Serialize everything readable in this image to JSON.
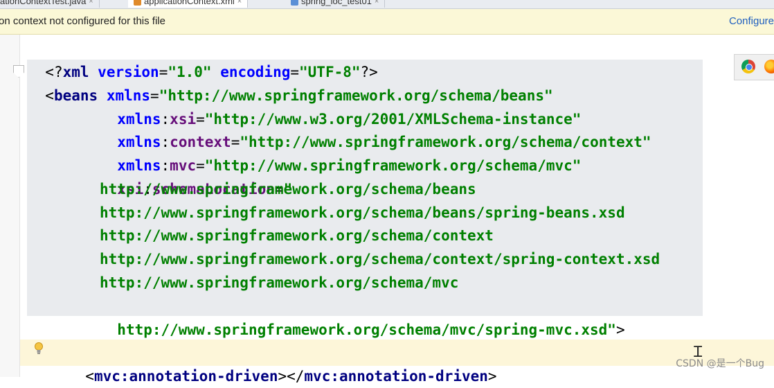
{
  "tabs": [
    {
      "label": "ationContextTest.java",
      "close": "×",
      "active": false
    },
    {
      "label": "applicationContext.xml",
      "close": "×",
      "active": true
    },
    {
      "label": "spring_ioc_test01",
      "close": "×",
      "active": false
    }
  ],
  "banner": {
    "message": "on context not configured for this file",
    "action": "Configure"
  },
  "code": {
    "line1": {
      "open": "<?",
      "tag": "xml",
      "attr1": " version",
      "eq1": "=",
      "val1": "\"1.0\"",
      "attr2": " encoding",
      "eq2": "=",
      "val2": "\"UTF-8\"",
      "close": "?>"
    },
    "line2": {
      "open": "<",
      "tag": "beans",
      "attr": " xmlns",
      "eq": "=",
      "val": "\"http://www.springframework.org/schema/beans\""
    },
    "line3": {
      "prefix": "xmlns",
      "colon": ":",
      "name": "xsi",
      "eq": "=",
      "val": "\"http://www.w3.org/2001/XMLSchema-instance\""
    },
    "line4": {
      "prefix": "xmlns",
      "colon": ":",
      "name": "context",
      "eq": "=",
      "val": "\"http://www.springframework.org/schema/context\""
    },
    "line5": {
      "prefix": "xmlns",
      "colon": ":",
      "name": "mvc",
      "eq": "=",
      "val": "\"http://www.springframework.org/schema/mvc\""
    },
    "line6": {
      "prefix": "xsi",
      "colon": ":",
      "name": "schemaLocation",
      "eq": "=",
      "val": "\""
    },
    "line7": "http://www.springframework.org/schema/beans",
    "line8": "http://www.springframework.org/schema/beans/spring-beans.xsd",
    "line9": "http://www.springframework.org/schema/context",
    "line10": "http://www.springframework.org/schema/context/spring-context.xsd",
    "line11": "http://www.springframework.org/schema/mvc",
    "line12": {
      "val": "http://www.springframework.org/schema/mvc/spring-mvc.xsd\"",
      "close": ">"
    },
    "line14": {
      "open": "<",
      "tag1": "mvc:annotation-driven",
      "mid": "></",
      "tag2": "mvc:annotation-driven",
      "close": ">"
    }
  },
  "watermark": "CSDN @是一个Bug",
  "icons": {
    "bulb": "lightbulb-icon",
    "chrome": "chrome-icon",
    "firefox": "firefox-icon",
    "cursor": "text-cursor-icon",
    "fold": "fold-icon"
  },
  "colors": {
    "tag": "#000080",
    "attribute": "#0000ff",
    "namespace": "#660e7a",
    "value": "#008000",
    "banner_bg": "#fbf8d7",
    "link": "#1f5fbf"
  }
}
